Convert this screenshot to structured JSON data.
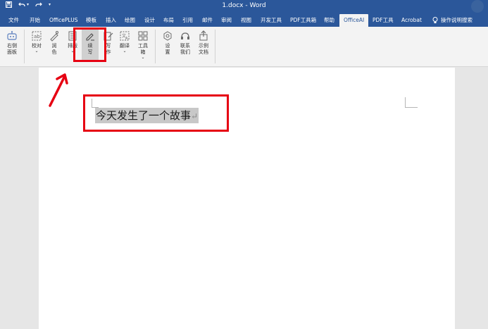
{
  "window": {
    "title": "1.docx - Word"
  },
  "tabs": [
    {
      "label": "文件"
    },
    {
      "label": "开始"
    },
    {
      "label": "OfficePLUS"
    },
    {
      "label": "模板"
    },
    {
      "label": "插入"
    },
    {
      "label": "绘图"
    },
    {
      "label": "设计"
    },
    {
      "label": "布局"
    },
    {
      "label": "引用"
    },
    {
      "label": "邮件"
    },
    {
      "label": "审阅"
    },
    {
      "label": "视图"
    },
    {
      "label": "开发工具"
    },
    {
      "label": "PDF工具箱"
    },
    {
      "label": "帮助"
    },
    {
      "label": "OfficeAI",
      "active": true
    },
    {
      "label": "PDF工具"
    },
    {
      "label": "Acrobat"
    }
  ],
  "tell_me": {
    "label": "操作说明搜索"
  },
  "ribbon": {
    "buttons": [
      {
        "label": "右侧\n面板",
        "icon": "robot-icon"
      },
      {
        "label": "校对",
        "icon": "proofread-icon",
        "dropdown": true
      },
      {
        "label": "润\n色",
        "icon": "polish-icon"
      },
      {
        "label": "排版",
        "icon": "layout-icon",
        "dropdown": true
      },
      {
        "label": "续\n写",
        "icon": "continue-write-icon",
        "selected": true
      },
      {
        "label": "写\n作",
        "icon": "write-icon"
      },
      {
        "label": "翻译",
        "icon": "translate-icon",
        "dropdown": true
      },
      {
        "label": "工具\n箱",
        "icon": "toolbox-icon",
        "dropdown": true
      },
      {
        "label": "设\n置",
        "icon": "settings-icon"
      },
      {
        "label": "联系\n我们",
        "icon": "contact-icon"
      },
      {
        "label": "示例\n文档",
        "icon": "sample-doc-icon"
      }
    ]
  },
  "document": {
    "text": "今天发生了一个故事",
    "paragraph_mark": "↵"
  },
  "colors": {
    "title_bar": "#2b579a",
    "ribbon_bg": "#f3f3f3",
    "annotation_red": "#e60012"
  }
}
